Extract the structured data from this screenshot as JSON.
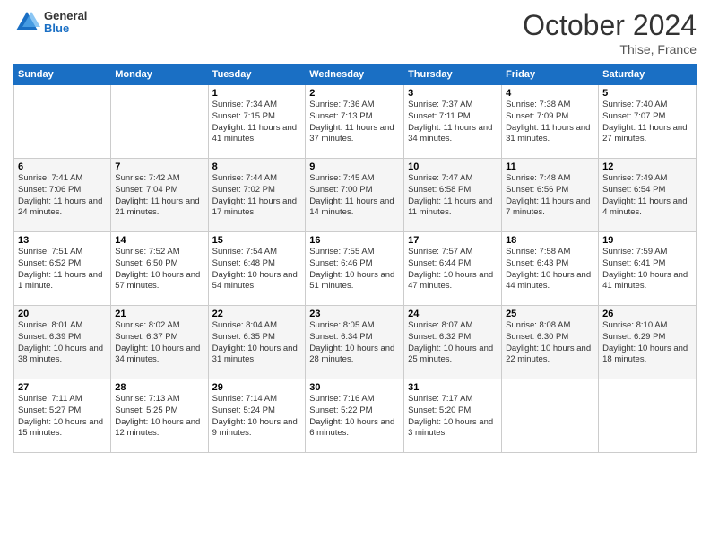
{
  "logo": {
    "general": "General",
    "blue": "Blue"
  },
  "title": "October 2024",
  "location": "Thise, France",
  "days_of_week": [
    "Sunday",
    "Monday",
    "Tuesday",
    "Wednesday",
    "Thursday",
    "Friday",
    "Saturday"
  ],
  "weeks": [
    [
      {
        "day": "",
        "sunrise": "",
        "sunset": "",
        "daylight": ""
      },
      {
        "day": "",
        "sunrise": "",
        "sunset": "",
        "daylight": ""
      },
      {
        "day": "1",
        "sunrise": "Sunrise: 7:34 AM",
        "sunset": "Sunset: 7:15 PM",
        "daylight": "Daylight: 11 hours and 41 minutes."
      },
      {
        "day": "2",
        "sunrise": "Sunrise: 7:36 AM",
        "sunset": "Sunset: 7:13 PM",
        "daylight": "Daylight: 11 hours and 37 minutes."
      },
      {
        "day": "3",
        "sunrise": "Sunrise: 7:37 AM",
        "sunset": "Sunset: 7:11 PM",
        "daylight": "Daylight: 11 hours and 34 minutes."
      },
      {
        "day": "4",
        "sunrise": "Sunrise: 7:38 AM",
        "sunset": "Sunset: 7:09 PM",
        "daylight": "Daylight: 11 hours and 31 minutes."
      },
      {
        "day": "5",
        "sunrise": "Sunrise: 7:40 AM",
        "sunset": "Sunset: 7:07 PM",
        "daylight": "Daylight: 11 hours and 27 minutes."
      }
    ],
    [
      {
        "day": "6",
        "sunrise": "Sunrise: 7:41 AM",
        "sunset": "Sunset: 7:06 PM",
        "daylight": "Daylight: 11 hours and 24 minutes."
      },
      {
        "day": "7",
        "sunrise": "Sunrise: 7:42 AM",
        "sunset": "Sunset: 7:04 PM",
        "daylight": "Daylight: 11 hours and 21 minutes."
      },
      {
        "day": "8",
        "sunrise": "Sunrise: 7:44 AM",
        "sunset": "Sunset: 7:02 PM",
        "daylight": "Daylight: 11 hours and 17 minutes."
      },
      {
        "day": "9",
        "sunrise": "Sunrise: 7:45 AM",
        "sunset": "Sunset: 7:00 PM",
        "daylight": "Daylight: 11 hours and 14 minutes."
      },
      {
        "day": "10",
        "sunrise": "Sunrise: 7:47 AM",
        "sunset": "Sunset: 6:58 PM",
        "daylight": "Daylight: 11 hours and 11 minutes."
      },
      {
        "day": "11",
        "sunrise": "Sunrise: 7:48 AM",
        "sunset": "Sunset: 6:56 PM",
        "daylight": "Daylight: 11 hours and 7 minutes."
      },
      {
        "day": "12",
        "sunrise": "Sunrise: 7:49 AM",
        "sunset": "Sunset: 6:54 PM",
        "daylight": "Daylight: 11 hours and 4 minutes."
      }
    ],
    [
      {
        "day": "13",
        "sunrise": "Sunrise: 7:51 AM",
        "sunset": "Sunset: 6:52 PM",
        "daylight": "Daylight: 11 hours and 1 minute."
      },
      {
        "day": "14",
        "sunrise": "Sunrise: 7:52 AM",
        "sunset": "Sunset: 6:50 PM",
        "daylight": "Daylight: 10 hours and 57 minutes."
      },
      {
        "day": "15",
        "sunrise": "Sunrise: 7:54 AM",
        "sunset": "Sunset: 6:48 PM",
        "daylight": "Daylight: 10 hours and 54 minutes."
      },
      {
        "day": "16",
        "sunrise": "Sunrise: 7:55 AM",
        "sunset": "Sunset: 6:46 PM",
        "daylight": "Daylight: 10 hours and 51 minutes."
      },
      {
        "day": "17",
        "sunrise": "Sunrise: 7:57 AM",
        "sunset": "Sunset: 6:44 PM",
        "daylight": "Daylight: 10 hours and 47 minutes."
      },
      {
        "day": "18",
        "sunrise": "Sunrise: 7:58 AM",
        "sunset": "Sunset: 6:43 PM",
        "daylight": "Daylight: 10 hours and 44 minutes."
      },
      {
        "day": "19",
        "sunrise": "Sunrise: 7:59 AM",
        "sunset": "Sunset: 6:41 PM",
        "daylight": "Daylight: 10 hours and 41 minutes."
      }
    ],
    [
      {
        "day": "20",
        "sunrise": "Sunrise: 8:01 AM",
        "sunset": "Sunset: 6:39 PM",
        "daylight": "Daylight: 10 hours and 38 minutes."
      },
      {
        "day": "21",
        "sunrise": "Sunrise: 8:02 AM",
        "sunset": "Sunset: 6:37 PM",
        "daylight": "Daylight: 10 hours and 34 minutes."
      },
      {
        "day": "22",
        "sunrise": "Sunrise: 8:04 AM",
        "sunset": "Sunset: 6:35 PM",
        "daylight": "Daylight: 10 hours and 31 minutes."
      },
      {
        "day": "23",
        "sunrise": "Sunrise: 8:05 AM",
        "sunset": "Sunset: 6:34 PM",
        "daylight": "Daylight: 10 hours and 28 minutes."
      },
      {
        "day": "24",
        "sunrise": "Sunrise: 8:07 AM",
        "sunset": "Sunset: 6:32 PM",
        "daylight": "Daylight: 10 hours and 25 minutes."
      },
      {
        "day": "25",
        "sunrise": "Sunrise: 8:08 AM",
        "sunset": "Sunset: 6:30 PM",
        "daylight": "Daylight: 10 hours and 22 minutes."
      },
      {
        "day": "26",
        "sunrise": "Sunrise: 8:10 AM",
        "sunset": "Sunset: 6:29 PM",
        "daylight": "Daylight: 10 hours and 18 minutes."
      }
    ],
    [
      {
        "day": "27",
        "sunrise": "Sunrise: 7:11 AM",
        "sunset": "Sunset: 5:27 PM",
        "daylight": "Daylight: 10 hours and 15 minutes."
      },
      {
        "day": "28",
        "sunrise": "Sunrise: 7:13 AM",
        "sunset": "Sunset: 5:25 PM",
        "daylight": "Daylight: 10 hours and 12 minutes."
      },
      {
        "day": "29",
        "sunrise": "Sunrise: 7:14 AM",
        "sunset": "Sunset: 5:24 PM",
        "daylight": "Daylight: 10 hours and 9 minutes."
      },
      {
        "day": "30",
        "sunrise": "Sunrise: 7:16 AM",
        "sunset": "Sunset: 5:22 PM",
        "daylight": "Daylight: 10 hours and 6 minutes."
      },
      {
        "day": "31",
        "sunrise": "Sunrise: 7:17 AM",
        "sunset": "Sunset: 5:20 PM",
        "daylight": "Daylight: 10 hours and 3 minutes."
      },
      {
        "day": "",
        "sunrise": "",
        "sunset": "",
        "daylight": ""
      },
      {
        "day": "",
        "sunrise": "",
        "sunset": "",
        "daylight": ""
      }
    ]
  ]
}
